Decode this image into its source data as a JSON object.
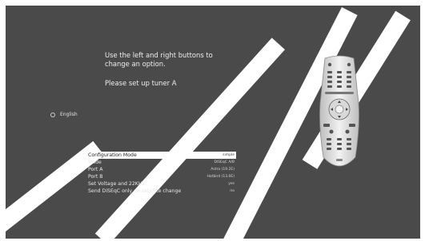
{
  "instructions": {
    "line1": "Use the left and right buttons to",
    "line2": "change an option.",
    "line3": "Please set up tuner A"
  },
  "language": {
    "label": "English"
  },
  "config_rows": [
    {
      "label": "Configuration Mode",
      "value": "simple",
      "selected": true
    },
    {
      "label": "Mode",
      "value": "DiSEqC A/B",
      "selected": false
    },
    {
      "label": "Port A",
      "value": "Astra (19.2E)",
      "selected": false
    },
    {
      "label": "Port B",
      "value": "Hotbird (13.0E)",
      "selected": false
    },
    {
      "label": "Set Voltage and 22KHz",
      "value": "yes",
      "selected": false
    },
    {
      "label": "Send DiSEqC only on satellite change",
      "value": "no",
      "selected": false
    }
  ],
  "remote": {
    "icon": "remote-control-icon"
  },
  "watermark": {
    "color": "#ffffff"
  }
}
